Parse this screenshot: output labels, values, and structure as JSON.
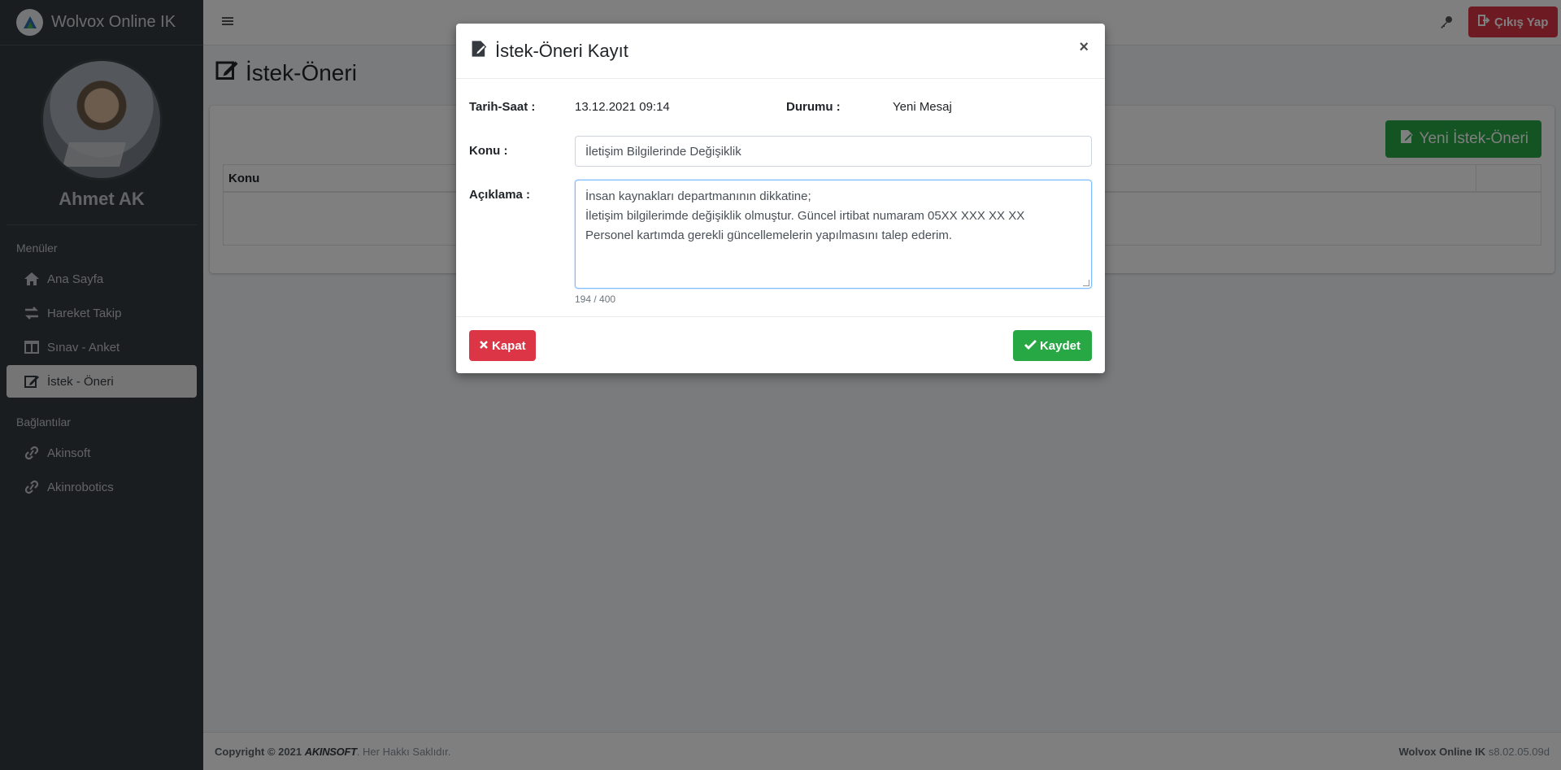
{
  "brand": {
    "name": "Wolvox Online IK"
  },
  "user": {
    "name": "Ahmet AK"
  },
  "sidebar": {
    "menus_header": "Menüler",
    "menu_items": [
      {
        "label": "Ana Sayfa",
        "icon": "home-icon"
      },
      {
        "label": "Hareket Takip",
        "icon": "exchange-icon"
      },
      {
        "label": "Sınav - Anket",
        "icon": "columns-icon"
      },
      {
        "label": "İstek - Öneri",
        "icon": "edit-icon",
        "active": true
      }
    ],
    "links_header": "Bağlantılar",
    "link_items": [
      {
        "label": "Akinsoft",
        "icon": "link-icon"
      },
      {
        "label": "Akinrobotics",
        "icon": "link-icon"
      }
    ]
  },
  "topnav": {
    "logout_label": "Çıkış Yap"
  },
  "page": {
    "title": "İstek-Öneri",
    "new_button": "Yeni İstek-Öneri",
    "table": {
      "headers": [
        "Konu",
        ""
      ]
    }
  },
  "footer": {
    "copyright": "Copyright © 2021",
    "company": "AKINSOFT",
    "rights": ". Her Hakkı Saklıdır.",
    "app_name": "Wolvox Online IK",
    "version": "s8.02.05.09d"
  },
  "modal": {
    "title": "İstek-Öneri Kayıt",
    "date_label": "Tarih-Saat :",
    "date_value": "13.12.2021 09:14",
    "status_label": "Durumu :",
    "status_value": "Yeni Mesaj",
    "subject_label": "Konu :",
    "subject_value": "İletişim Bilgilerinde Değişiklik",
    "desc_label": "Açıklama :",
    "desc_lines": [
      "İnsan kaynakları departmanının dikkatine;",
      "İletişim bilgilerimde değişiklik olmuştur. Güncel irtibat numaram 05XX XXX XX XX",
      "Personel kartımda gerekli güncellemelerin yapılmasını talep ederim."
    ],
    "char_count": "194 / 400",
    "close_label": "Kapat",
    "save_label": "Kaydet"
  },
  "colors": {
    "danger": "#dc3545",
    "success": "#28a745",
    "sidebar": "#343a40"
  }
}
